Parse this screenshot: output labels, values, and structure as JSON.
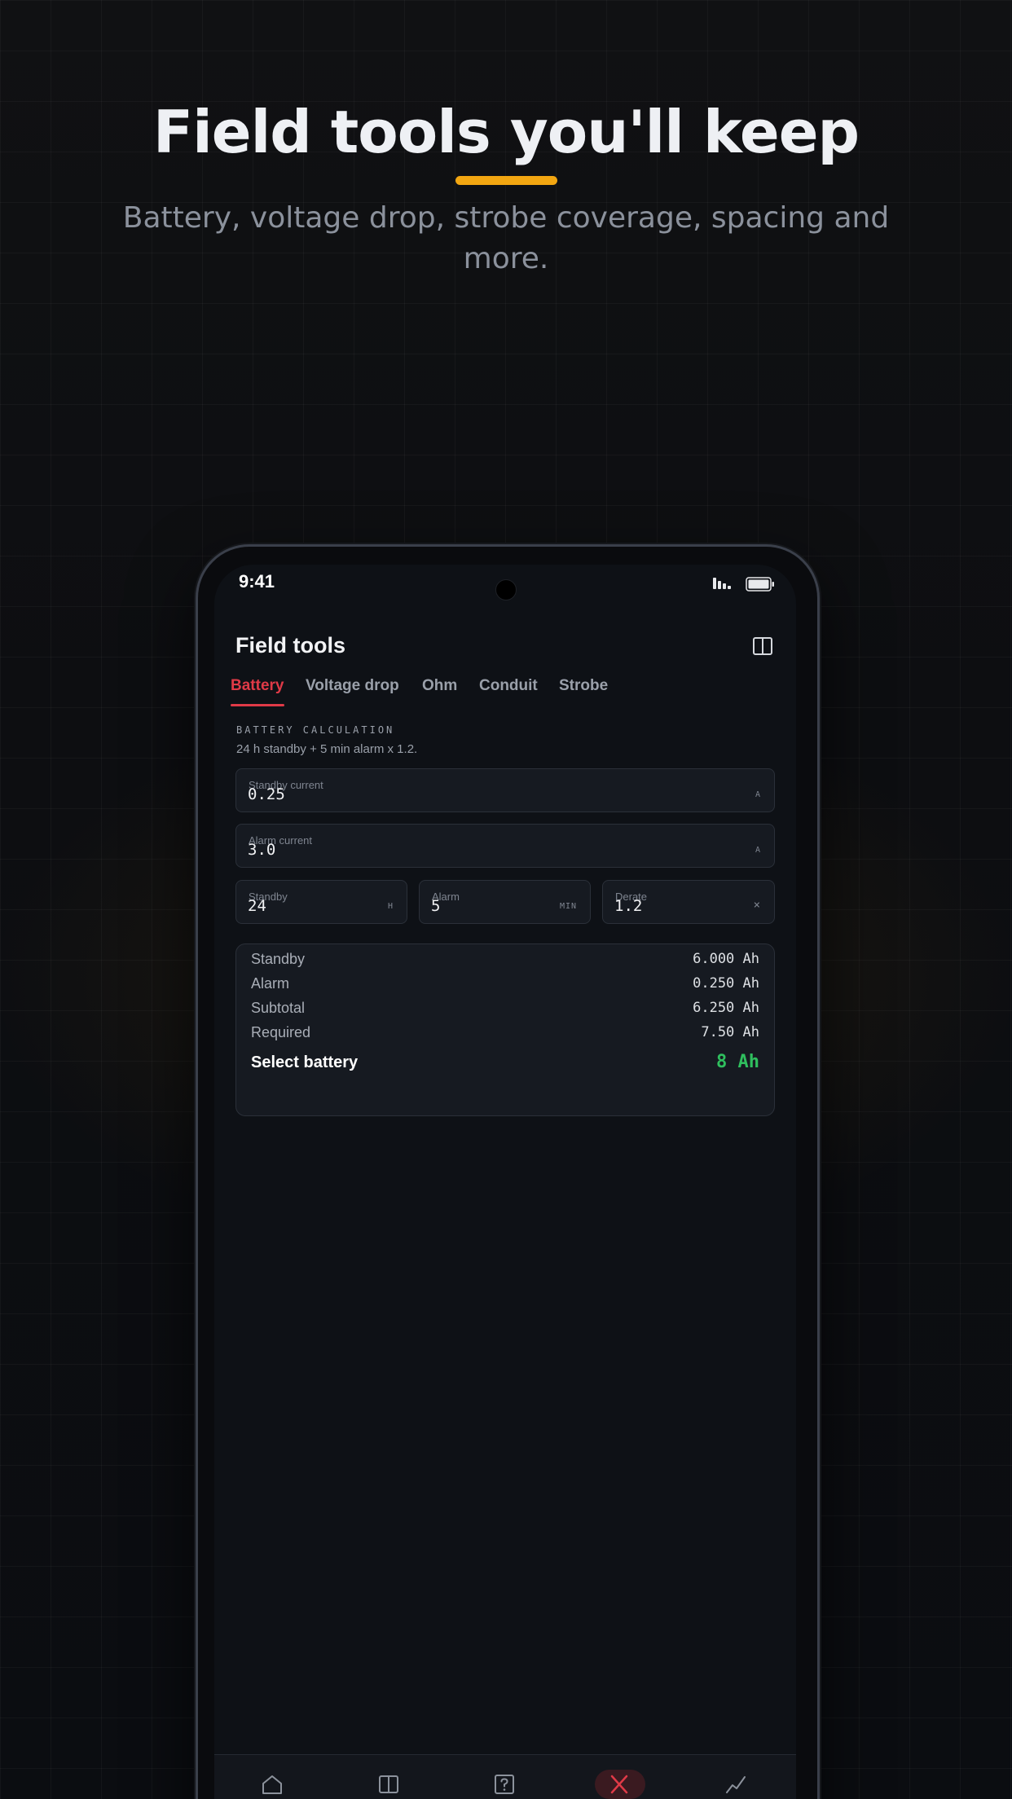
{
  "hero": {
    "title": "Field tools you'll keep",
    "subtitle": "Battery, voltage drop, strobe coverage, spacing and more."
  },
  "status_bar": {
    "time": "9:41"
  },
  "app": {
    "title": "Field tools",
    "tabs": [
      {
        "label": "Battery",
        "active": true
      },
      {
        "label": "Voltage drop",
        "active": false
      },
      {
        "label": "Ohm",
        "active": false
      },
      {
        "label": "Conduit",
        "active": false
      },
      {
        "label": "Strobe",
        "active": false
      }
    ],
    "section": {
      "label": "BATTERY CALCULATION",
      "description": "24 h standby + 5 min alarm x 1.2."
    },
    "fields": {
      "standby_current": {
        "label": "Standby current",
        "value": "0.25",
        "unit": "A"
      },
      "alarm_current": {
        "label": "Alarm current",
        "value": "3.0",
        "unit": "A"
      },
      "standby": {
        "label": "Standby",
        "value": "24",
        "unit": "H"
      },
      "alarm": {
        "label": "Alarm",
        "value": "5",
        "unit": "MIN"
      },
      "derate": {
        "label": "Derate",
        "value": "1.2",
        "unit": "×"
      }
    },
    "results": [
      {
        "label": "Standby",
        "value": "6.000 Ah"
      },
      {
        "label": "Alarm",
        "value": "0.250 Ah"
      },
      {
        "label": "Subtotal",
        "value": "6.250 Ah"
      },
      {
        "label": "Required",
        "value": "7.50 Ah"
      }
    ],
    "selection": {
      "label": "Select battery",
      "value": "8 Ah"
    }
  },
  "nav": [
    {
      "icon": "home-icon",
      "active": false
    },
    {
      "icon": "panel-icon",
      "active": false
    },
    {
      "icon": "help-icon",
      "active": false
    },
    {
      "icon": "tools-icon",
      "active": true
    },
    {
      "icon": "chart-icon",
      "active": false
    }
  ],
  "colors": {
    "accent_red": "#e03a47",
    "highlight_yellow": "#f2a611",
    "success_green": "#2fbf5e"
  }
}
